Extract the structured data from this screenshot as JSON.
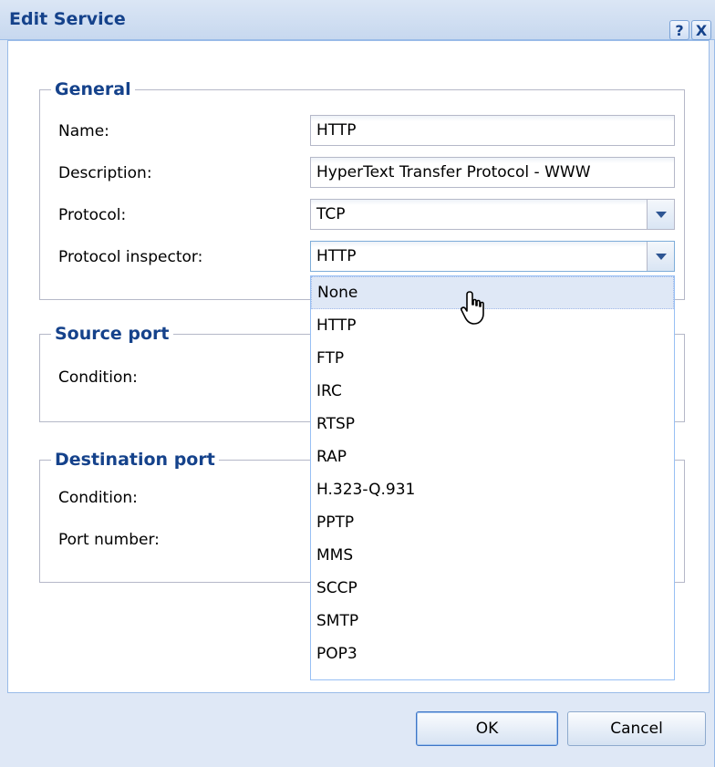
{
  "window": {
    "title": "Edit Service",
    "help_label": "?",
    "close_label": "X"
  },
  "general": {
    "legend": "General",
    "name_label": "Name:",
    "name_value": "HTTP",
    "description_label": "Description:",
    "description_value": "HyperText Transfer Protocol - WWW",
    "protocol_label": "Protocol:",
    "protocol_value": "TCP",
    "inspector_label": "Protocol inspector:",
    "inspector_value": "HTTP"
  },
  "source_port": {
    "legend": "Source port",
    "condition_label": "Condition:"
  },
  "destination_port": {
    "legend": "Destination port",
    "condition_label": "Condition:",
    "port_number_label": "Port number:"
  },
  "inspector_dropdown": {
    "options": [
      "None",
      "HTTP",
      "FTP",
      "IRC",
      "RTSP",
      "RAP",
      "H.323-Q.931",
      "PPTP",
      "MMS",
      "SCCP",
      "SMTP",
      "POP3"
    ],
    "highlighted": "None"
  },
  "buttons": {
    "ok": "OK",
    "cancel": "Cancel"
  },
  "colors": {
    "title_text": "#15428b",
    "window_bg": "#dfe8f6",
    "highlight_bg": "#dfe8f6"
  }
}
